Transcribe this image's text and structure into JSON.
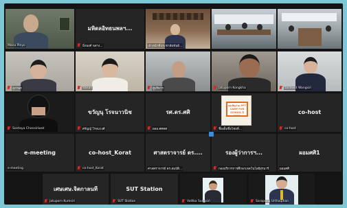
{
  "tiles": [
    {
      "name": "Mana Pinyo",
      "display": "",
      "row": 0,
      "col": 0,
      "active": true
    },
    {
      "name": "มิ่งนงค์ พสาง...",
      "display": "มหิดลอิทธนพลฯ...",
      "row": 0,
      "col": 1
    },
    {
      "name": "เจ้าหน้าที่ประชาสัมพันธ์...",
      "display": "",
      "row": 0,
      "col": 2
    },
    {
      "name": "",
      "display": "",
      "row": 0,
      "col": 3
    },
    {
      "name": "",
      "display": "",
      "row": 0,
      "col": 4
    },
    {
      "name": "สุภาพร",
      "display": "",
      "row": 1,
      "col": 0
    },
    {
      "name": "Sanan",
      "display": "",
      "row": 1,
      "col": 1
    },
    {
      "name": "ผู้บริหาร",
      "display": "",
      "row": 1,
      "col": 2
    },
    {
      "name": "Jatuporn Kongkha",
      "display": "",
      "row": 1,
      "col": 3
    },
    {
      "name": "Sarawut Wongsiri",
      "display": "",
      "row": 1,
      "col": 4
    },
    {
      "name": "Sontaya Chansiriwat",
      "display": "",
      "row": 2,
      "col": 0
    },
    {
      "name": "ศรัญญ์ โรจนวงศ์",
      "display": "ขวัญนุ โรจนาวนิช",
      "row": 2,
      "col": 1
    },
    {
      "name": "ผลอ.ศศคศ",
      "display": "รศ.ดร.ศศิ",
      "row": 2,
      "col": 2
    },
    {
      "name": "ชื่อเต็มชื่อไทยที่...",
      "display": "",
      "row": 2,
      "col": 3
    },
    {
      "name": "co-host",
      "display": "co-host",
      "row": 2,
      "col": 4
    },
    {
      "name": "e-meeting",
      "display": "e-meeting",
      "row": 3,
      "col": 0
    },
    {
      "name": "co-host_Korat",
      "display": "co-host_Korat",
      "row": 3,
      "col": 1
    },
    {
      "name": "ศาสตราจารย์ ดร.สมบัติ...",
      "display": "ศาสตราจารย์ ดร....",
      "row": 3,
      "col": 2
    },
    {
      "name": "กองบริการการศึกษาเทคโนโลยีสุรนารี",
      "display": "รองผู้ว่าการฯ...",
      "row": 3,
      "col": 3
    },
    {
      "name": "ผอมศศิ",
      "display": "ผอมศศิ1",
      "row": 3,
      "col": 4
    },
    {
      "name": "Jatuporn Kumsiri",
      "display": "เศษเศษ.จิตกาลนที",
      "row": 4,
      "col": 1
    },
    {
      "name": "SUT Station",
      "display": "SUT Station",
      "row": 4,
      "col": 2
    },
    {
      "name": "Vallika Sungsiri",
      "display": "",
      "row": 4,
      "col": 3
    },
    {
      "name": "Sarapong Urthaiphan",
      "display": "",
      "row": 4,
      "col": 4
    }
  ],
  "share_card_text": "ขอเชิญร่วม PPT CAMP FOR SCHOOL ปี 2565",
  "accent_color": "#d8e06a",
  "muted_icon": "mic-off-icon"
}
